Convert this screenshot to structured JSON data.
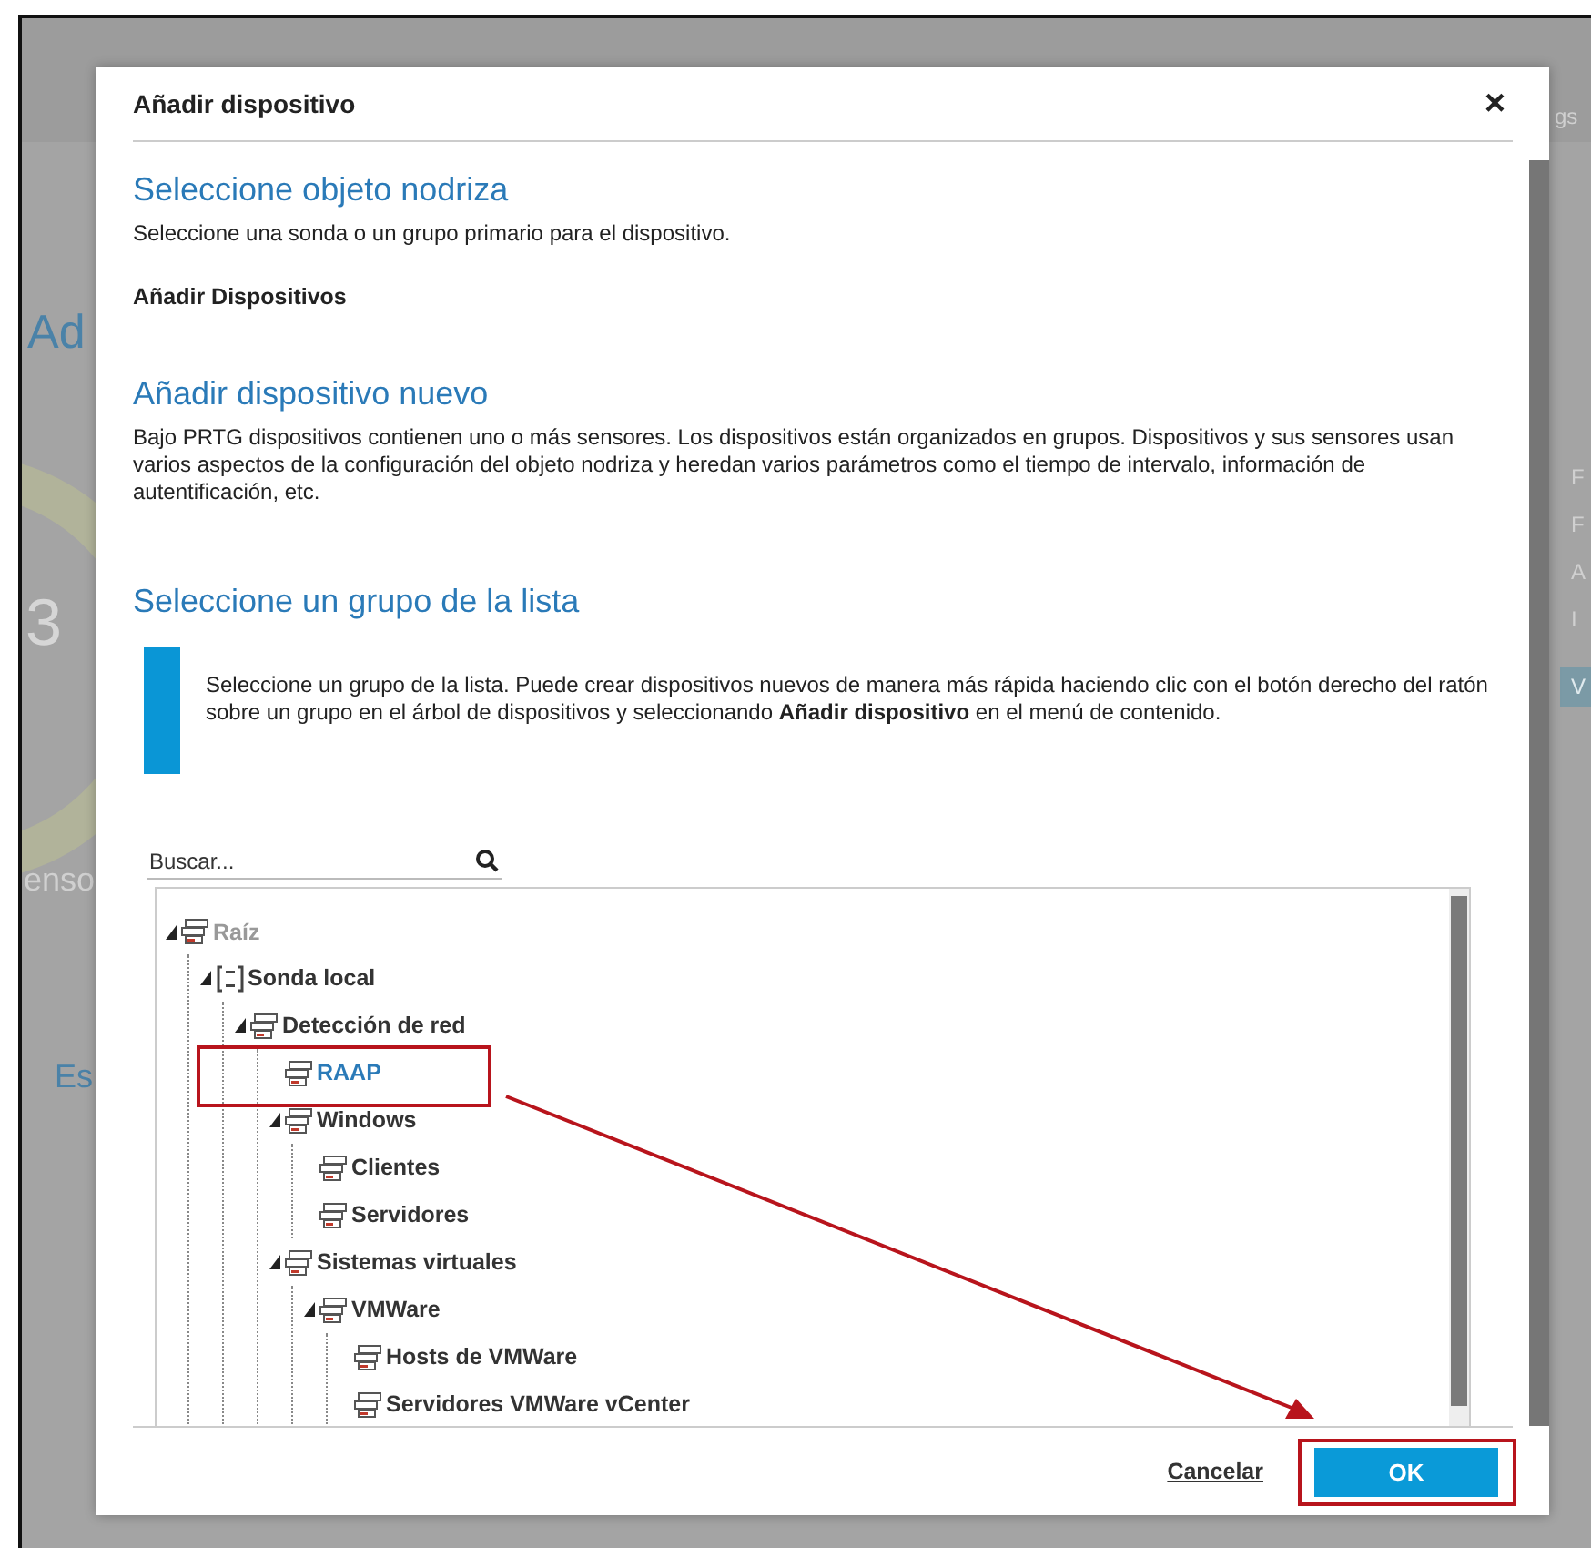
{
  "background": {
    "fragments": [
      "Ad",
      "3",
      "enso",
      "Es",
      "gs",
      "F",
      "F",
      "A",
      "I"
    ],
    "button": "V"
  },
  "dialog": {
    "title": "Añadir dispositivo",
    "close": "×",
    "sections": [
      {
        "heading": "Seleccione objeto nodriza",
        "text": "Seleccione una sonda o un grupo primario para el dispositivo.",
        "note": "Añadir Dispositivos"
      },
      {
        "heading": "Añadir dispositivo nuevo",
        "text": "Bajo PRTG dispositivos contienen uno o más sensores. Los dispositivos están organizados en grupos. Dispositivos y sus sensores usan varios aspectos de la configuración del objeto nodriza y heredan varios parámetros como el tiempo de intervalo, información de autentificación, etc."
      },
      {
        "heading": "Seleccione un grupo de la lista"
      }
    ],
    "info": "Seleccione un grupo de la lista. Puede crear dispositivos nuevos de manera más rápida haciendo clic con el botón derecho del ratón sobre un grupo en el árbol de dispositivos y seleccionando **Añadir dispositivo** en el menú de contenido.",
    "search": {
      "placeholder": "Buscar..."
    },
    "tree": [
      {
        "label": "Raíz",
        "kind": "group",
        "expanded": true,
        "selected": false,
        "disabled": true,
        "children": [
          {
            "label": "Sonda local",
            "kind": "probe",
            "expanded": true,
            "selected": false,
            "disabled": false,
            "children": [
              {
                "label": "Detección de red",
                "kind": "group",
                "expanded": true,
                "selected": false,
                "disabled": false,
                "children": [
                  {
                    "label": "RAAP",
                    "kind": "group",
                    "expanded": false,
                    "selected": true,
                    "disabled": false
                  },
                  {
                    "label": "Windows",
                    "kind": "group",
                    "expanded": true,
                    "selected": false,
                    "disabled": false,
                    "children": [
                      {
                        "label": "Clientes",
                        "kind": "group",
                        "expanded": false,
                        "selected": false,
                        "disabled": false
                      },
                      {
                        "label": "Servidores",
                        "kind": "group",
                        "expanded": false,
                        "selected": false,
                        "disabled": false
                      }
                    ]
                  },
                  {
                    "label": "Sistemas virtuales",
                    "kind": "group",
                    "expanded": true,
                    "selected": false,
                    "disabled": false,
                    "children": [
                      {
                        "label": "VMWare",
                        "kind": "group",
                        "expanded": true,
                        "selected": false,
                        "disabled": false,
                        "children": [
                          {
                            "label": "Hosts de VMWare",
                            "kind": "group",
                            "expanded": false,
                            "selected": false,
                            "disabled": false
                          },
                          {
                            "label": "Servidores VMWare vCenter",
                            "kind": "group",
                            "expanded": false,
                            "selected": false,
                            "disabled": false
                          }
                        ]
                      }
                    ]
                  }
                ]
              }
            ]
          }
        ]
      }
    ],
    "buttons": [
      {
        "label": "Cancelar",
        "kind": "link"
      },
      {
        "label": "OK",
        "kind": "primary"
      }
    ]
  }
}
